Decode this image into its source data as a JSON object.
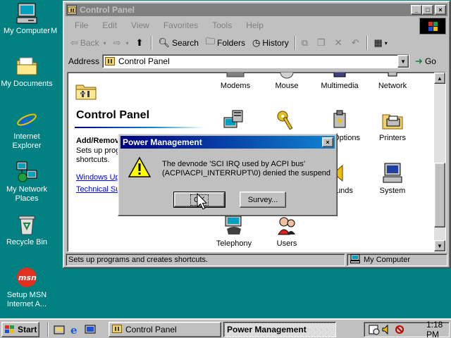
{
  "desktop": {
    "icons": [
      {
        "label": "My Computer",
        "icon": "my-computer-icon"
      },
      {
        "label": "My Documents",
        "icon": "folder-icon"
      },
      {
        "label": "Internet Explorer",
        "icon": "internet-explorer-icon"
      },
      {
        "label": "My Network Places",
        "icon": "network-icon"
      },
      {
        "label": "Recycle Bin",
        "icon": "recycle-bin-icon"
      },
      {
        "label": "Setup MSN Internet A...",
        "icon": "msn-icon"
      }
    ],
    "clipped_label": "M"
  },
  "window": {
    "title": "Control Panel",
    "controls": {
      "minimize": "_",
      "maximize": "□",
      "close": "×"
    },
    "menu": [
      "File",
      "Edit",
      "View",
      "Favorites",
      "Tools",
      "Help"
    ],
    "toolbar": {
      "back": "Back",
      "forward_icon": "forward-arrow-icon",
      "search": "Search",
      "folders": "Folders",
      "history": "History"
    },
    "address": {
      "label": "Address",
      "value": "Control Panel",
      "go": "Go"
    },
    "left_pane": {
      "title": "Control Panel",
      "subheading": "Add/Remov",
      "description": "Sets up progr shortcuts.",
      "links": [
        "Windows Upd",
        "Technical Sup"
      ]
    },
    "items": [
      {
        "label": "Modems",
        "icon": "modem-icon"
      },
      {
        "label": "Mouse",
        "icon": "mouse-icon"
      },
      {
        "label": "Multimedia",
        "icon": "multimedia-icon"
      },
      {
        "label": "Network",
        "icon": "network-icon"
      },
      {
        "label": "",
        "icon": "passwords-icon"
      },
      {
        "label": "",
        "icon": "keys-icon"
      },
      {
        "label": "Options",
        "icon": "power-options-icon"
      },
      {
        "label": "Printers",
        "icon": "printer-icon"
      },
      {
        "label": "unds",
        "icon": "sounds-icon"
      },
      {
        "label": "System",
        "icon": "system-icon"
      },
      {
        "label": "Telephony",
        "icon": "telephony-icon"
      },
      {
        "label": "Users",
        "icon": "users-icon"
      }
    ],
    "status": {
      "left": "Sets up programs and creates shortcuts.",
      "right": "My Computer"
    }
  },
  "dialog": {
    "title": "Power Management",
    "close": "×",
    "message_line1": "The devnode 'SCI IRQ used by ACPI bus'",
    "message_line2": "(ACPI\\ACPI_INTERRUPT\\0) denied the suspend",
    "ok_label": "OK",
    "survey_label": "Survey..."
  },
  "taskbar": {
    "start_label": "Start",
    "tasks": [
      {
        "label": "Control Panel",
        "active": false
      },
      {
        "label": "Power Management",
        "active": true
      }
    ],
    "clock": "1:18 PM"
  },
  "colors": {
    "desktop": "#008080",
    "title_active_start": "#000080",
    "title_active_end": "#1084d0",
    "title_inactive": "#808080",
    "face": "#c0c0c0"
  }
}
